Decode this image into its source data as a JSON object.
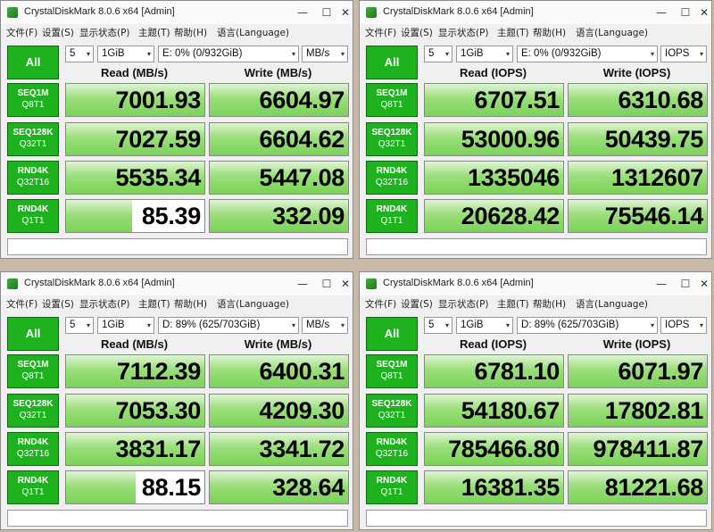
{
  "app": {
    "title": "CrystalDiskMark 8.0.6 x64 [Admin]",
    "minimize_glyph": "—",
    "maximize_glyph": "☐",
    "close_glyph": "✕",
    "menu": [
      "文件(F)",
      "设置(S)",
      "显示状态(P)",
      "主题(T)",
      "帮助(H)",
      "语言(Language)"
    ],
    "all_label": "All",
    "count": "5",
    "size": "1GiB",
    "dropdown_glyph": "▾"
  },
  "tests": [
    {
      "l1": "SEQ1M",
      "l2": "Q8T1"
    },
    {
      "l1": "SEQ128K",
      "l2": "Q32T1"
    },
    {
      "l1": "RND4K",
      "l2": "Q32T16"
    },
    {
      "l1": "RND4K",
      "l2": "Q1T1"
    }
  ],
  "windows": [
    {
      "drive": "E: 0% (0/932GiB)",
      "unit": "MB/s",
      "read_header": "Read (MB/s)",
      "write_header": "Write (MB/s)",
      "results": [
        {
          "read": "7001.93",
          "write": "6604.97",
          "read_fill": 1.0,
          "write_fill": 1.0
        },
        {
          "read": "7027.59",
          "write": "6604.62",
          "read_fill": 1.0,
          "write_fill": 1.0
        },
        {
          "read": "5535.34",
          "write": "5447.08",
          "read_fill": 1.0,
          "write_fill": 1.0
        },
        {
          "read": "85.39",
          "write": "332.09",
          "read_fill": 0.48,
          "write_fill": 1.0
        }
      ]
    },
    {
      "drive": "E: 0% (0/932GiB)",
      "unit": "IOPS",
      "read_header": "Read (IOPS)",
      "write_header": "Write (IOPS)",
      "results": [
        {
          "read": "6707.51",
          "write": "6310.68",
          "read_fill": 1.0,
          "write_fill": 1.0
        },
        {
          "read": "53000.96",
          "write": "50439.75",
          "read_fill": 1.0,
          "write_fill": 1.0
        },
        {
          "read": "1335046",
          "write": "1312607",
          "read_fill": 1.0,
          "write_fill": 1.0
        },
        {
          "read": "20628.42",
          "write": "75546.14",
          "read_fill": 1.0,
          "write_fill": 1.0
        }
      ]
    },
    {
      "drive": "D: 89% (625/703GiB)",
      "unit": "MB/s",
      "read_header": "Read (MB/s)",
      "write_header": "Write (MB/s)",
      "results": [
        {
          "read": "7112.39",
          "write": "6400.31",
          "read_fill": 1.0,
          "write_fill": 1.0
        },
        {
          "read": "7053.30",
          "write": "4209.30",
          "read_fill": 1.0,
          "write_fill": 1.0
        },
        {
          "read": "3831.17",
          "write": "3341.72",
          "read_fill": 1.0,
          "write_fill": 1.0
        },
        {
          "read": "88.15",
          "write": "328.64",
          "read_fill": 0.5,
          "write_fill": 1.0
        }
      ]
    },
    {
      "drive": "D: 89% (625/703GiB)",
      "unit": "IOPS",
      "read_header": "Read (IOPS)",
      "write_header": "Write (IOPS)",
      "results": [
        {
          "read": "6781.10",
          "write": "6071.97",
          "read_fill": 1.0,
          "write_fill": 1.0
        },
        {
          "read": "54180.67",
          "write": "17802.81",
          "read_fill": 1.0,
          "write_fill": 1.0
        },
        {
          "read": "785466.80",
          "write": "978411.87",
          "read_fill": 1.0,
          "write_fill": 1.0
        },
        {
          "read": "16381.35",
          "write": "81221.68",
          "read_fill": 1.0,
          "write_fill": 1.0
        }
      ]
    }
  ]
}
